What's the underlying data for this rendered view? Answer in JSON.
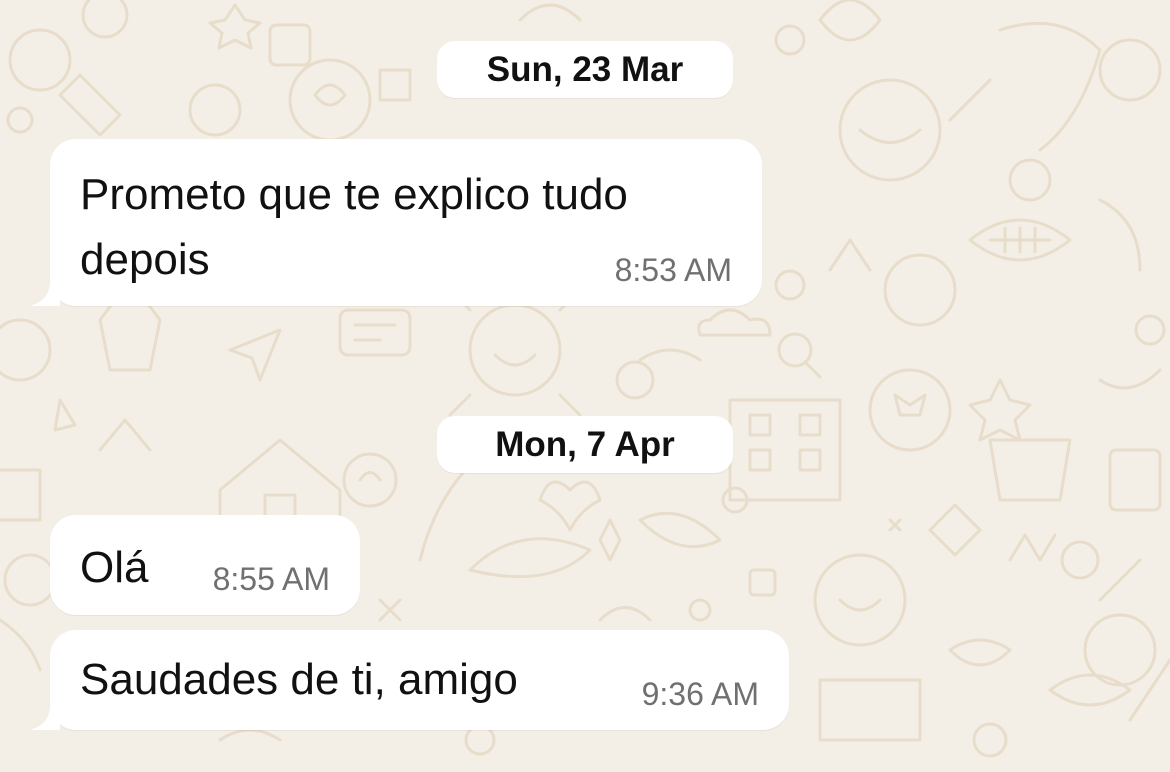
{
  "chat": {
    "background_color": "#f4efe6",
    "bubble_color": "#ffffff",
    "date_separators": [
      {
        "label": "Sun, 23 Mar"
      },
      {
        "label": "Mon, 7 Apr"
      }
    ],
    "messages": [
      {
        "text": "Prometo que te explico tudo depois",
        "time": "8:53 AM",
        "direction": "incoming"
      },
      {
        "text": "Olá",
        "time": "8:55 AM",
        "direction": "incoming"
      },
      {
        "text": "Saudades de ti, amigo",
        "time": "9:36 AM",
        "direction": "incoming"
      }
    ]
  }
}
